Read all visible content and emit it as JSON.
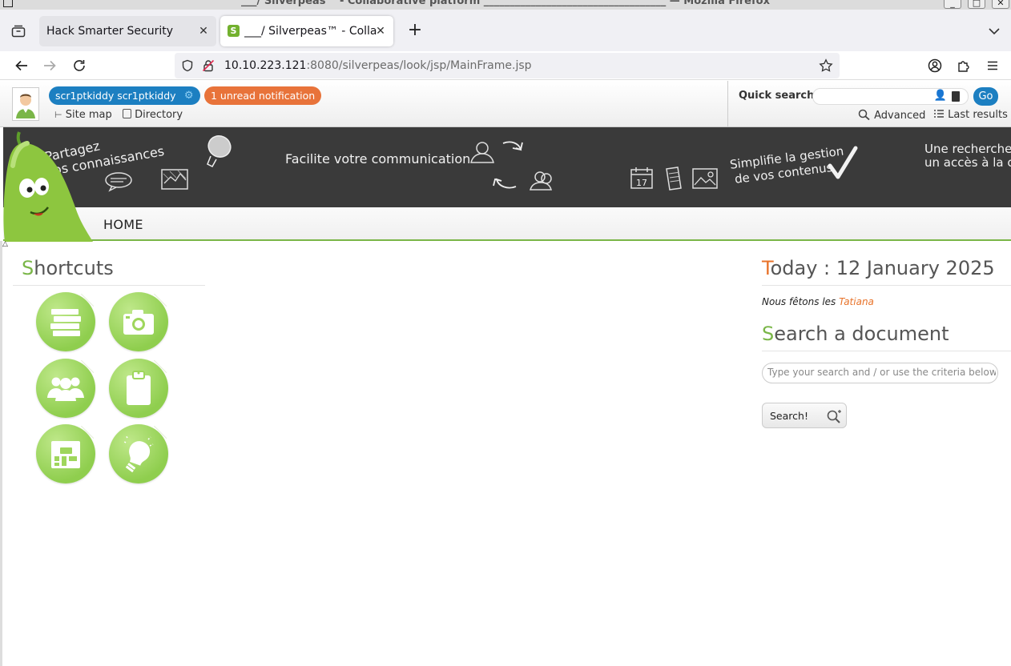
{
  "window": {
    "title": "___/ Silverpeas™ - Collaborative platform ___________________________________ — Mozilla Firefox"
  },
  "browser": {
    "tabs": [
      {
        "label": "Hack Smarter Security",
        "active": false
      },
      {
        "label": "___/ Silverpeas™ - Collaborative platform",
        "active": true
      }
    ],
    "url_host": "10.10.223.121",
    "url_rest": ":8080/silverpeas/look/jsp/MainFrame.jsp"
  },
  "header": {
    "user_name": "scr1ptkiddy scr1ptkiddy",
    "notification": "1 unread notification",
    "site_map": "Site map",
    "directory": "Directory",
    "quick_search_label": "Quick search",
    "quick_search_value": "",
    "go": "Go",
    "advanced": "Advanced",
    "last_results": "Last results"
  },
  "banner": {
    "slogan_1_line1": "Partagez",
    "slogan_1_line2": "vos connaissances",
    "slogan_2": "Facilite votre communication",
    "slogan_3_line1": "Simplifie la gestion",
    "slogan_3_line2": "de vos contenus",
    "slogan_4_line1": "Une recherche",
    "slogan_4_line2": "un accès à la co",
    "calendar_day": "17"
  },
  "menu": {
    "home": "HOME"
  },
  "shortcuts": {
    "title_first": "S",
    "title_rest": "hortcuts",
    "items": [
      {
        "icon": "books-icon"
      },
      {
        "icon": "camera-icon"
      },
      {
        "icon": "group-icon"
      },
      {
        "icon": "clipboard-icon"
      },
      {
        "icon": "calendar-board-icon"
      },
      {
        "icon": "lightbulb-icon"
      }
    ]
  },
  "today": {
    "title_first": "T",
    "title_rest": "oday : 12 January 2025",
    "feast_prefix": "Nous fêtons les",
    "feast_name": "Tatiana"
  },
  "doc_search": {
    "title_first": "S",
    "title_rest": "earch a document",
    "placeholder": "Type your search and / or use the criteria below",
    "button": "Search!"
  },
  "colors": {
    "accent_green": "#7ab648",
    "accent_orange": "#e8732a",
    "user_pill_blue": "#1c7fc1",
    "banner_dark": "#3a3a3a"
  }
}
